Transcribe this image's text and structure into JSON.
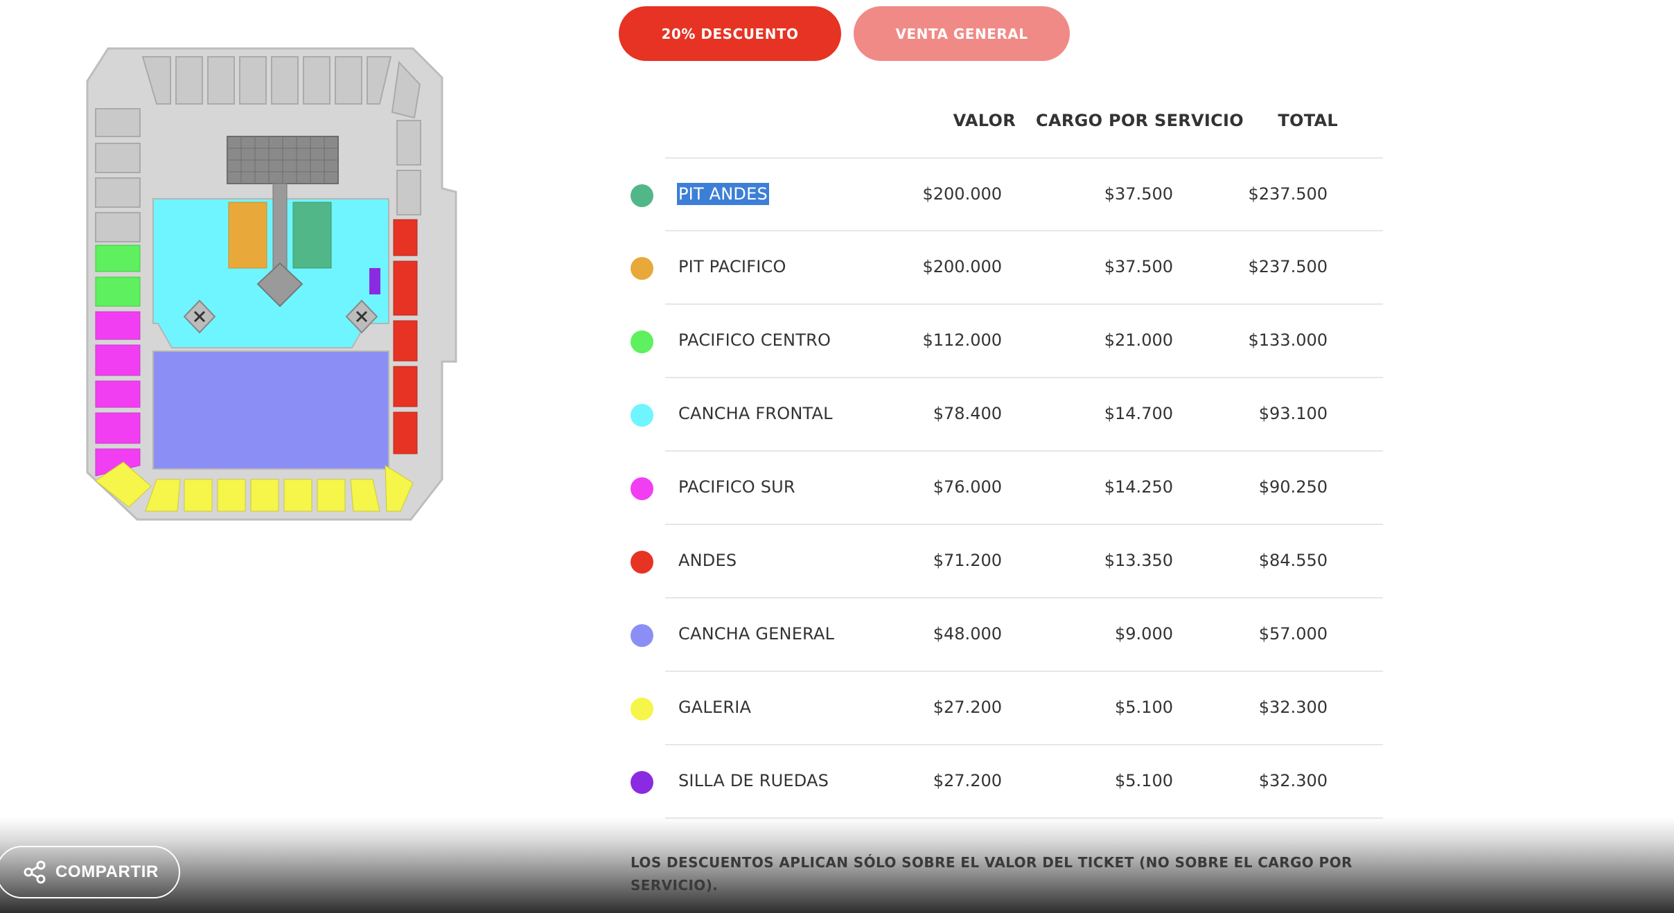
{
  "tabs": [
    {
      "label": "20% DESCUENTO",
      "active": true,
      "color": "#e63323"
    },
    {
      "label": "VENTA GENERAL",
      "active": false,
      "color": "#f08a86"
    }
  ],
  "table": {
    "columns": [
      "VALOR",
      "CARGO POR SERVICIO",
      "TOTAL"
    ],
    "rows": [
      {
        "zone": "PIT ANDES",
        "color": "#52b788",
        "valor": "$200.000",
        "cargo": "$37.500",
        "total": "$237.500",
        "selected": true
      },
      {
        "zone": "PIT PACIFICO",
        "color": "#e8a93a",
        "valor": "$200.000",
        "cargo": "$37.500",
        "total": "$237.500"
      },
      {
        "zone": "PACIFICO CENTRO",
        "color": "#5ef05e",
        "valor": "$112.000",
        "cargo": "$21.000",
        "total": "$133.000"
      },
      {
        "zone": "CANCHA FRONTAL",
        "color": "#6ff5ff",
        "valor": "$78.400",
        "cargo": "$14.700",
        "total": "$93.100"
      },
      {
        "zone": "PACIFICO SUR",
        "color": "#f23ef2",
        "valor": "$76.000",
        "cargo": "$14.250",
        "total": "$90.250"
      },
      {
        "zone": "ANDES",
        "color": "#e63323",
        "valor": "$71.200",
        "cargo": "$13.350",
        "total": "$84.550"
      },
      {
        "zone": "CANCHA GENERAL",
        "color": "#8b8ff5",
        "valor": "$48.000",
        "cargo": "$9.000",
        "total": "$57.000"
      },
      {
        "zone": "GALERIA",
        "color": "#f5f54a",
        "valor": "$27.200",
        "cargo": "$5.100",
        "total": "$32.300"
      },
      {
        "zone": "SILLA DE RUEDAS",
        "color": "#8a2be2",
        "valor": "$27.200",
        "cargo": "$5.100",
        "total": "$32.300"
      }
    ]
  },
  "share": {
    "label": "COMPARTIR",
    "icon": "share-icon"
  },
  "disclaimer": "LOS DESCUENTOS APLICAN SÓLO SOBRE EL VALOR DEL TICKET (NO SOBRE EL CARGO POR SERVICIO).",
  "map": {
    "colors": {
      "pit_andes": "#52b788",
      "pit_pacifico": "#e8a93a",
      "pacifico_centro": "#5ef05e",
      "cancha_frontal": "#6ff5ff",
      "pacifico_sur": "#f23ef2",
      "andes": "#e63323",
      "cancha_general": "#8b8ff5",
      "galeria": "#f5f54a",
      "silla_de_ruedas": "#8a2be2",
      "structure": "#d6d6d6"
    }
  }
}
